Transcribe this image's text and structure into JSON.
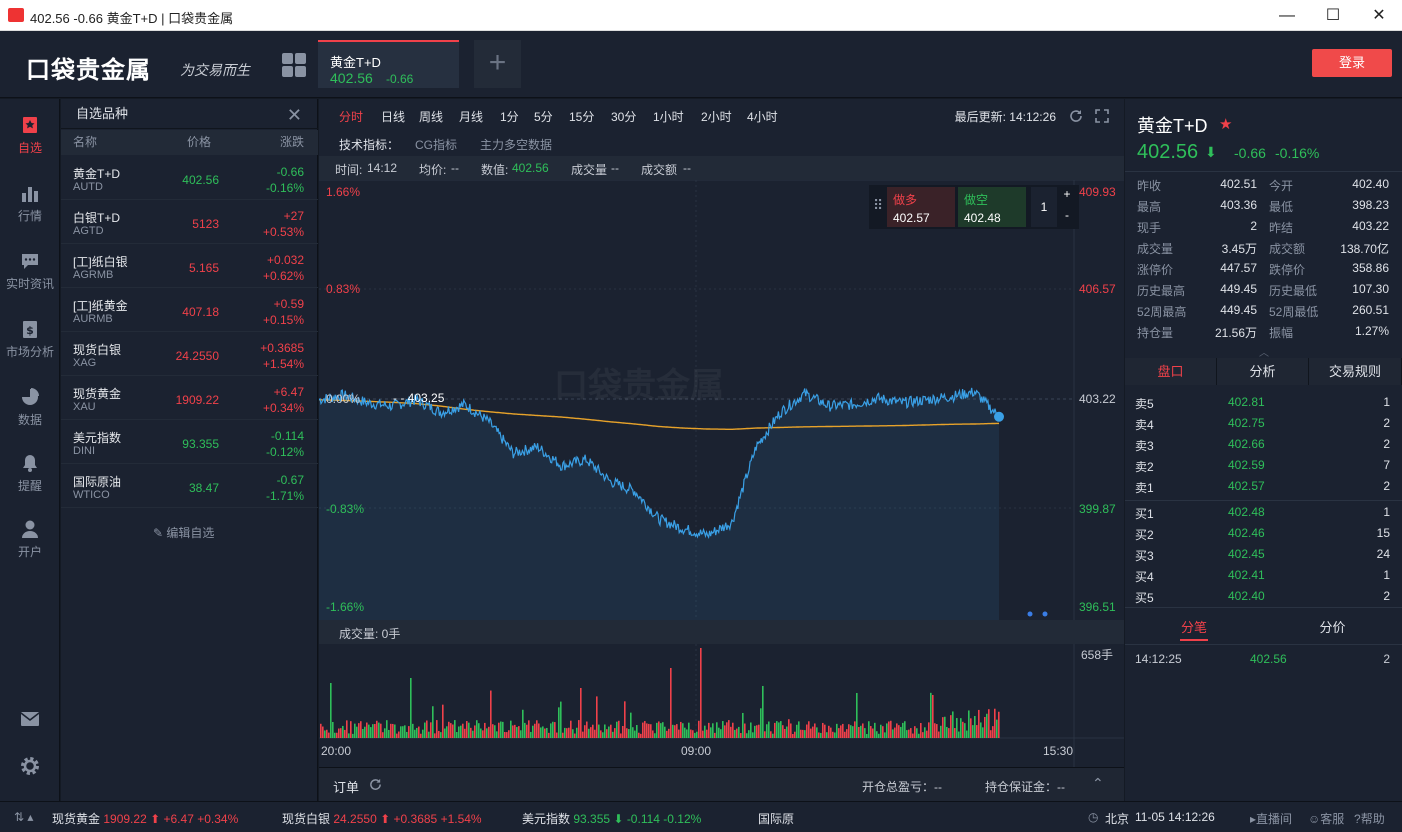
{
  "window": {
    "title": "402.56 -0.66 黄金T+D | 口袋贵金属",
    "min": "—",
    "max": "☐",
    "close": "✕"
  },
  "header": {
    "logo": "口袋贵金属",
    "slogan": "为交易而生",
    "tab": {
      "name": "黄金T+D",
      "price": "402.56",
      "change": "-0.66"
    },
    "add": "+",
    "login": "登录"
  },
  "nav": [
    {
      "label": "自选",
      "icon": "star-icon"
    },
    {
      "label": "行情",
      "icon": "bar-chart-icon"
    },
    {
      "label": "实时资讯",
      "icon": "chat-icon"
    },
    {
      "label": "市场分析",
      "icon": "dollar-icon"
    },
    {
      "label": "数据",
      "icon": "pie-icon"
    },
    {
      "label": "提醒",
      "icon": "bell-icon"
    },
    {
      "label": "开户",
      "icon": "user-icon"
    }
  ],
  "watchlist": {
    "title": "自选品种",
    "close": "✕",
    "cols": [
      "名称",
      "价格",
      "涨跌"
    ],
    "edit": "编辑自选",
    "items": [
      {
        "name": "黄金T+D",
        "code": "AUTD",
        "price": "402.56",
        "change": "-0.66",
        "pct": "-0.16%",
        "dir": "down"
      },
      {
        "name": "白银T+D",
        "code": "AGTD",
        "price": "5123",
        "change": "+27",
        "pct": "+0.53%",
        "dir": "up"
      },
      {
        "name": "[工]纸白银",
        "code": "AGRMB",
        "price": "5.165",
        "change": "+0.032",
        "pct": "+0.62%",
        "dir": "up"
      },
      {
        "name": "[工]纸黄金",
        "code": "AURMB",
        "price": "407.18",
        "change": "+0.59",
        "pct": "+0.15%",
        "dir": "up"
      },
      {
        "name": "现货白银",
        "code": "XAG",
        "price": "24.2550",
        "change": "+0.3685",
        "pct": "+1.54%",
        "dir": "up"
      },
      {
        "name": "现货黄金",
        "code": "XAU",
        "price": "1909.22",
        "change": "+6.47",
        "pct": "+0.34%",
        "dir": "up"
      },
      {
        "name": "美元指数",
        "code": "DINI",
        "price": "93.355",
        "change": "-0.114",
        "pct": "-0.12%",
        "dir": "down"
      },
      {
        "name": "国际原油",
        "code": "WTICO",
        "price": "38.47",
        "change": "-0.67",
        "pct": "-1.71%",
        "dir": "down"
      }
    ]
  },
  "chart": {
    "timeframes": [
      "分时",
      "日线",
      "周线",
      "月线",
      "1分",
      "5分",
      "15分",
      "30分",
      "1小时",
      "2小时",
      "4小时"
    ],
    "updated": "最后更新: 14:12:26",
    "indicator_label": "技术指标：",
    "indicators": [
      "CG指标",
      "主力多空数据"
    ],
    "info": {
      "time_l": "时间:",
      "time": "14:12",
      "avg_l": "均价:",
      "avg": "--",
      "val_l": "数值:",
      "val": "402.56",
      "vol_l": "成交量",
      "vol": "--",
      "amt_l": "成交额",
      "amt": "--"
    },
    "trade": {
      "long": "做多",
      "long_p": "402.57",
      "short": "做空",
      "short_p": "402.48",
      "qty": "1",
      "plus": "+",
      "minus": "-"
    },
    "y_left": [
      "1.66%",
      "0.83%",
      "0.00%",
      "-0.83%",
      "-1.66%"
    ],
    "y_right": [
      "409.93",
      "406.57",
      "403.22",
      "399.87",
      "396.51"
    ],
    "peak": "403.25",
    "watermark": "口袋贵金属",
    "vol_label": "成交量: 0手",
    "vol_max": "658手",
    "x_labels": [
      "20:00",
      "09:00",
      "15:30"
    ],
    "order": {
      "title": "订单",
      "pl": "开仓总盈亏：--",
      "margin": "持仓保证金：--"
    },
    "colors": {
      "price": "#3aa0e6",
      "avg": "#e8a32a",
      "volume_up": "#f0414a",
      "volume_down": "#2fbf5a"
    }
  },
  "chart_data": {
    "type": "line",
    "title": "",
    "xlabel": "",
    "ylabel": "",
    "x_ticks": [
      "20:00",
      "09:00",
      "15:30"
    ],
    "ylim": [
      396.51,
      409.93
    ],
    "series": [
      {
        "values": [
          403.1,
          403.25,
          403.0,
          402.9,
          403.1,
          402.7,
          402.95,
          402.4,
          401.4,
          401.6,
          401.0,
          401.2,
          400.5,
          400.2,
          399.3,
          399.0,
          398.8,
          399.2,
          401.6,
          402.7,
          403.3,
          402.9,
          402.95,
          403.15,
          403.0,
          403.1,
          403.2,
          403.35,
          402.56
        ]
      },
      {
        "values": [
          403.1,
          403.08,
          403.05,
          403.02,
          402.98,
          402.9,
          402.8,
          402.72,
          402.65,
          402.6,
          402.55,
          402.48,
          402.4,
          402.33,
          402.25,
          402.2,
          402.17,
          402.16,
          402.2,
          402.22,
          402.24,
          402.25,
          402.26,
          402.27,
          402.28,
          402.3,
          402.32,
          402.33,
          402.35
        ]
      }
    ]
  },
  "quote": {
    "name": "黄金T+D",
    "star": "★",
    "price": "402.56",
    "arrow": "⬇",
    "change": "-0.66",
    "pct": "-0.16%",
    "fields": [
      [
        "昨收",
        "402.51",
        "今开",
        "402.40"
      ],
      [
        "最高",
        "403.36",
        "最低",
        "398.23"
      ],
      [
        "现手",
        "2",
        "昨结",
        "403.22"
      ],
      [
        "成交量",
        "3.45万",
        "成交额",
        "138.70亿"
      ],
      [
        "涨停价",
        "447.57",
        "跌停价",
        "358.86"
      ],
      [
        "历史最高",
        "449.45",
        "历史最低",
        "107.30"
      ],
      [
        "52周最高",
        "449.45",
        "52周最低",
        "260.51"
      ],
      [
        "持仓量",
        "21.56万",
        "振幅",
        "1.27%"
      ]
    ],
    "tabs": [
      "盘口",
      "分析",
      "交易规则"
    ],
    "asks": [
      [
        "卖5",
        "402.81",
        "1"
      ],
      [
        "卖4",
        "402.75",
        "2"
      ],
      [
        "卖3",
        "402.66",
        "2"
      ],
      [
        "卖2",
        "402.59",
        "7"
      ],
      [
        "卖1",
        "402.57",
        "2"
      ]
    ],
    "bids": [
      [
        "买1",
        "402.48",
        "1"
      ],
      [
        "买2",
        "402.46",
        "15"
      ],
      [
        "买3",
        "402.45",
        "24"
      ],
      [
        "买4",
        "402.41",
        "1"
      ],
      [
        "买5",
        "402.40",
        "2"
      ]
    ],
    "tabs2": [
      "分笔",
      "分价"
    ],
    "tick": [
      "14:12:25",
      "402.56",
      "2"
    ]
  },
  "status": {
    "items": [
      {
        "name": "现货黄金",
        "price": "1909.22",
        "arrow": "⬆",
        "change": "+6.47",
        "pct": "+0.34%"
      },
      {
        "name": "现货白银",
        "price": "24.2550",
        "arrow": "⬆",
        "change": "+0.3685",
        "pct": "+1.54%"
      },
      {
        "name": "美元指数",
        "price": "93.355",
        "arrow": "⬇",
        "change": "-0.114",
        "pct": "-0.12%"
      }
    ],
    "cut": "国际原",
    "loc": "北京",
    "time": "11-05 14:12:26",
    "live": "直播间",
    "service": "客服",
    "help": "帮助"
  }
}
